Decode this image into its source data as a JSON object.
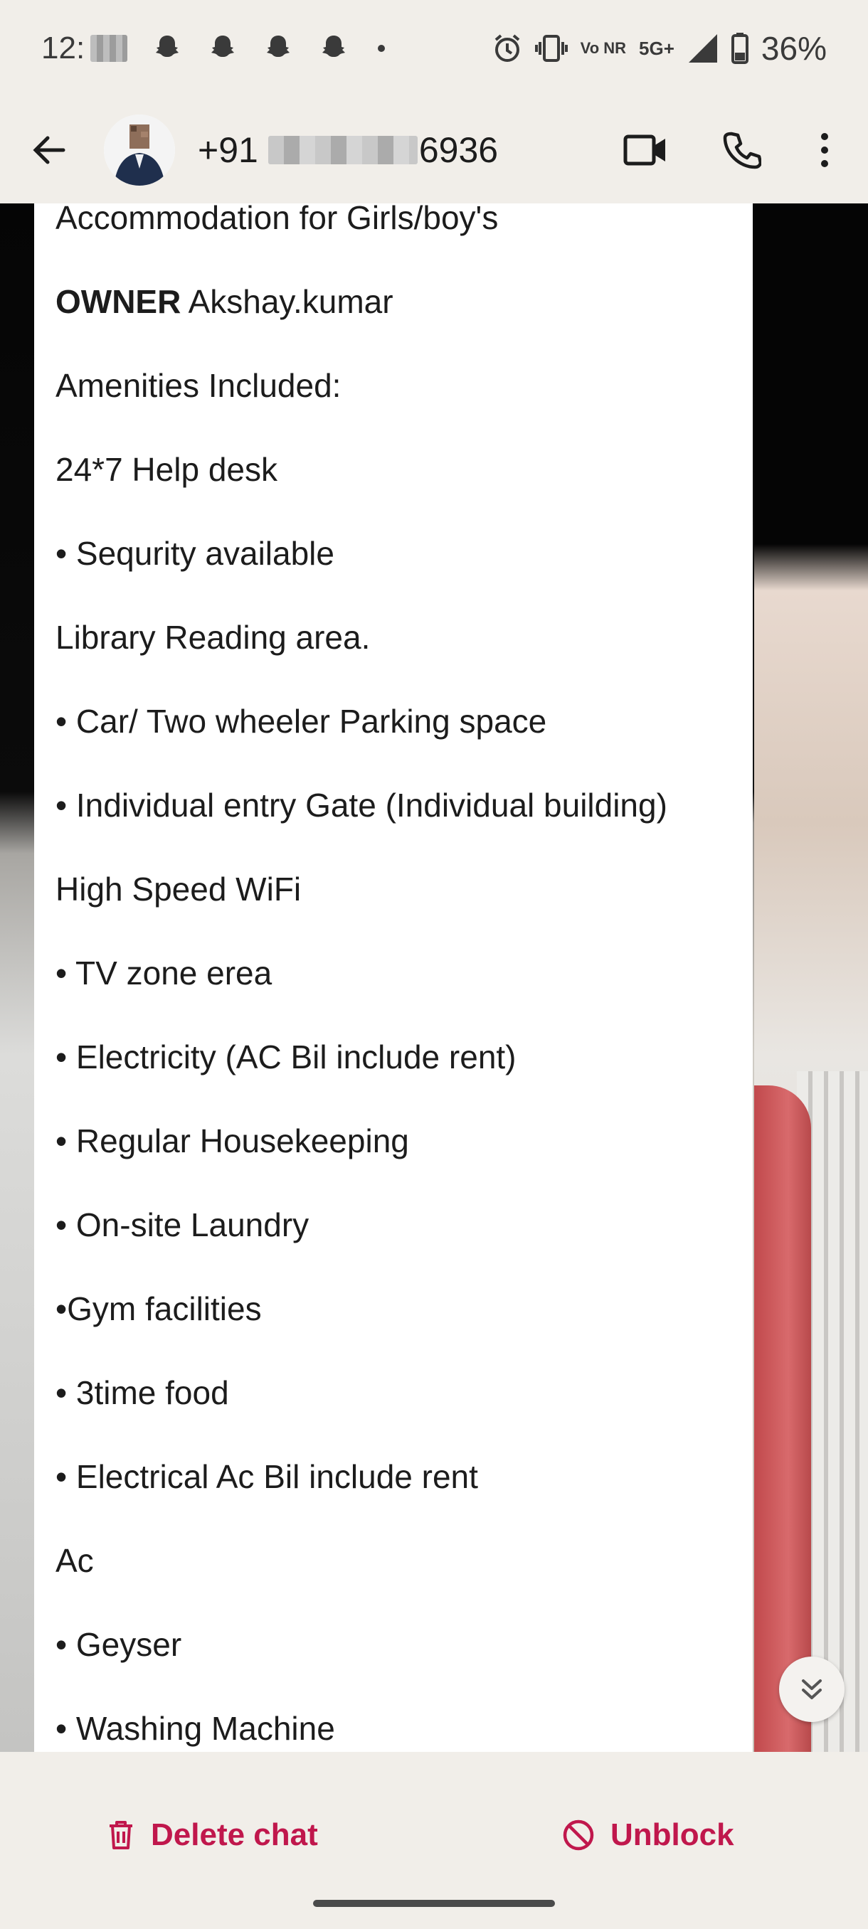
{
  "status_bar": {
    "time_prefix": "12:",
    "network": "Vo NR",
    "network_gen": "5G+",
    "battery": "36%"
  },
  "header": {
    "contact_prefix": "+91",
    "contact_suffix": "6936"
  },
  "message": {
    "lines": [
      {
        "text": "Accommodation for Girls/boy's"
      },
      {
        "bold": "OWNER",
        "text": " Akshay.kumar"
      },
      {
        "text": "Amenities Included:"
      },
      {
        "text": "24*7 Help desk"
      },
      {
        "text": "• Sequrity available"
      },
      {
        "text": "Library Reading area."
      },
      {
        "text": "• Car/ Two wheeler Parking space"
      },
      {
        "text": "• Individual entry Gate (Individual building)"
      },
      {
        "text": "High Speed WiFi"
      },
      {
        "text": "• TV zone erea"
      },
      {
        "text": "• Electricity (AC Bil include rent)"
      },
      {
        "text": "• Regular Housekeeping"
      },
      {
        "text": "• On-site Laundry"
      },
      {
        "text": "•Gym facilities"
      },
      {
        "text": "• 3time food"
      },
      {
        "text": "• Electrical Ac Bil include rent"
      },
      {
        "text": "Ac"
      },
      {
        "text": "• Geyser"
      },
      {
        "text": "• Washing Machine"
      }
    ]
  },
  "bottom_bar": {
    "delete_label": "Delete chat",
    "unblock_label": "Unblock"
  },
  "colors": {
    "accent": "#c0174c",
    "background": "#f1eee9"
  },
  "icons": [
    "snapchat-icon",
    "alarm-icon",
    "vibrate-icon",
    "signal-icon",
    "battery-icon",
    "back-arrow-icon",
    "video-call-icon",
    "phone-icon",
    "more-vert-icon",
    "double-chevron-down-icon",
    "trash-icon",
    "block-icon"
  ]
}
